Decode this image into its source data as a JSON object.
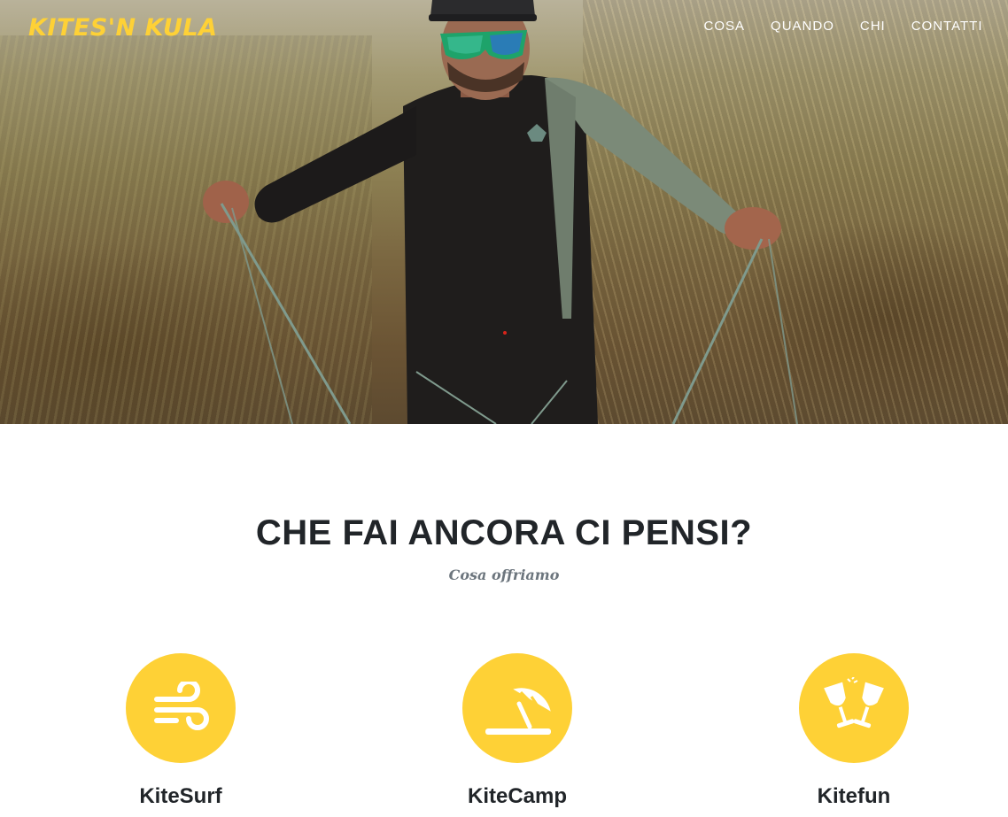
{
  "brand": "KITES'N KULA",
  "nav": {
    "items": [
      {
        "label": "COSA"
      },
      {
        "label": "QUANDO"
      },
      {
        "label": "CHI"
      },
      {
        "label": "CONTATTI"
      }
    ]
  },
  "hero": {
    "image": "kitesurfer-holding-lines-in-dunes"
  },
  "services": {
    "heading": "CHE FAI ANCORA CI PENSI?",
    "subheading": "Cosa offriamo",
    "items": [
      {
        "title": "KiteSurf",
        "icon": "wind-icon"
      },
      {
        "title": "KiteCamp",
        "icon": "beach-umbrella-icon"
      },
      {
        "title": "Kitefun",
        "icon": "champagne-glasses-icon"
      }
    ]
  },
  "colors": {
    "accent": "#fed136",
    "heading": "#212529",
    "muted": "#6c757d"
  }
}
